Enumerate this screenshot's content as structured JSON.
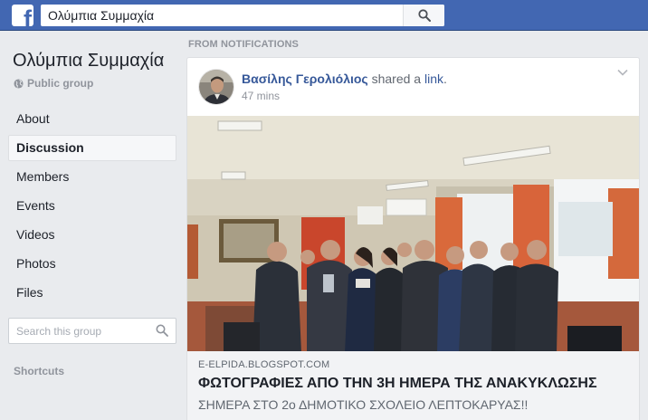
{
  "topbar": {
    "logo_letter": "f",
    "search_value": "Ολύμπια Συμμαχία",
    "brand_color": "#4267b2"
  },
  "sidebar": {
    "group_name": "Ολύμπια Συμμαχία",
    "privacy_label": "Public group",
    "items": [
      {
        "label": "About",
        "active": false
      },
      {
        "label": "Discussion",
        "active": true
      },
      {
        "label": "Members",
        "active": false
      },
      {
        "label": "Events",
        "active": false
      },
      {
        "label": "Videos",
        "active": false
      },
      {
        "label": "Photos",
        "active": false
      },
      {
        "label": "Files",
        "active": false
      }
    ],
    "search_placeholder": "Search this group",
    "shortcuts_label": "Shortcuts"
  },
  "feed": {
    "section_label": "FROM NOTIFICATIONS",
    "post": {
      "author": "Βασίλης Γερολιόλιος",
      "action_text": "shared a",
      "action_link": "link",
      "action_end": ".",
      "timestamp": "47 mins",
      "link_domain": "E-ELPIDA.BLOGSPOT.COM",
      "link_title": "ΦΩΤΟΓΡΑΦΙΕΣ ΑΠΟ ΤΗΝ 3Η ΗΜΕΡΑ ΤΗΣ ΑΝΑΚΥΚΛΩΣΗΣ",
      "link_description": "ΣΗΜΕΡΑ ΣΤΟ 2ο ΔΗΜΟΤΙΚΟ ΣΧΟΛΕΙΟ ΛΕΠΤΟΚΑΡΥΑΣ!!"
    }
  },
  "icons": {
    "logo": "facebook-logo-icon",
    "search": "search-icon",
    "globe": "globe-icon",
    "chevron": "chevron-down-icon"
  }
}
